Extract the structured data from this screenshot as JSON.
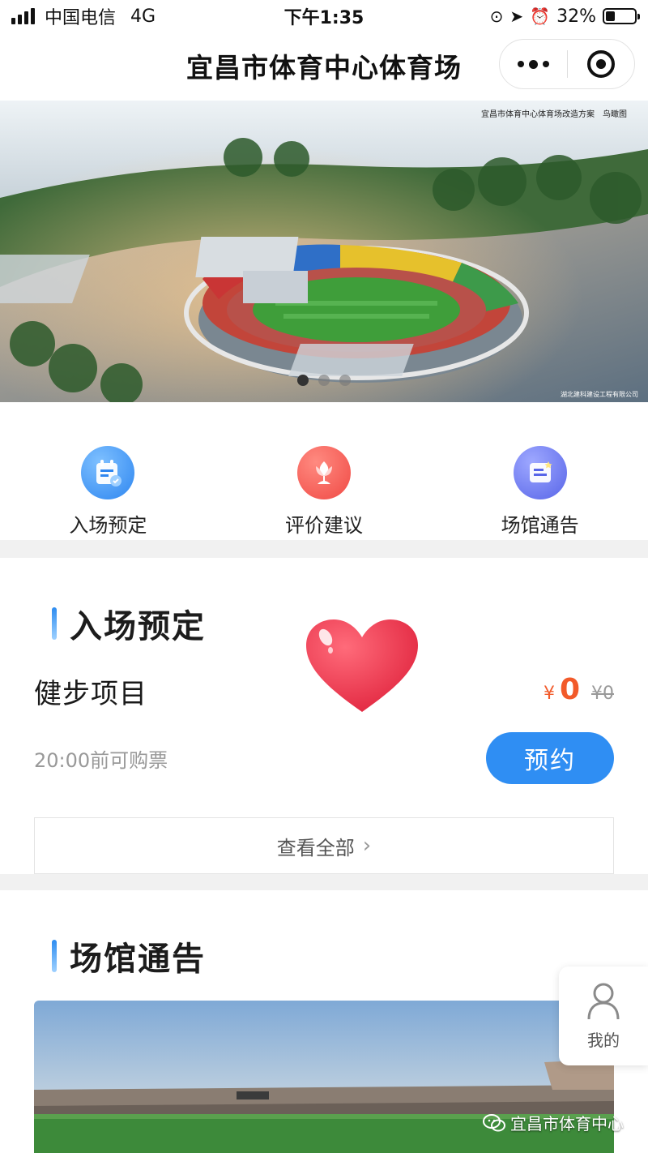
{
  "status_bar": {
    "carrier": "中国电信",
    "network": "4G",
    "time": "下午1:35",
    "battery": "32%",
    "battery_level": 0.32
  },
  "nav": {
    "title": "宜昌市体育中心体育场",
    "more_icon": "more-dots-icon",
    "close_icon": "target-close-icon"
  },
  "banner": {
    "caption": "宜昌市体育中心体育场改造方案　鸟瞰图",
    "credit": "湖北建科建设工程有限公司",
    "slide_count": 3,
    "active_slide": 1
  },
  "quick_menu": [
    {
      "label": "入场预定",
      "icon": "ticket-calendar-icon",
      "color": "#2e86f0"
    },
    {
      "label": "评价建议",
      "icon": "flower-icon",
      "color": "#f04a45"
    },
    {
      "label": "场馆通告",
      "icon": "notice-board-icon",
      "color": "#5865e8"
    }
  ],
  "booking": {
    "section_title": "入场预定",
    "item_name": "健步项目",
    "currency": "¥",
    "price": "0",
    "original_price": "¥0",
    "deadline": "20:00前可购票",
    "book_label": "预约",
    "view_all_label": "查看全部"
  },
  "notice": {
    "section_title": "场馆通告"
  },
  "float_me": {
    "label": "我的",
    "icon": "person-icon"
  },
  "watermark": {
    "text": "宜昌市体育中心",
    "icon": "wechat-icon"
  },
  "colors": {
    "accent": "#2f8ef3",
    "price": "#f25a2a"
  }
}
